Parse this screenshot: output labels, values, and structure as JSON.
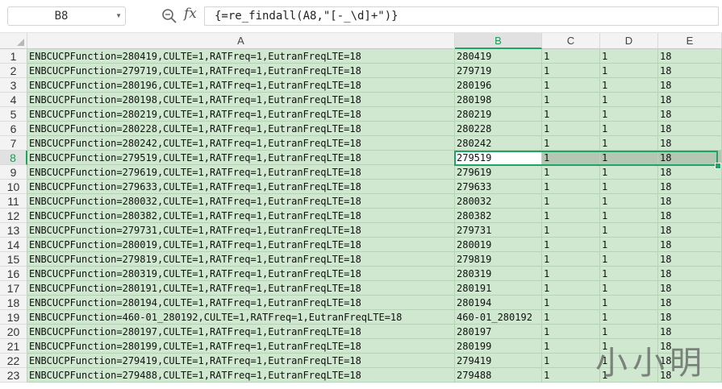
{
  "namebox": {
    "value": "B8"
  },
  "formula_bar": {
    "fx": "fx",
    "formula": "{=re_findall(A8,\"[-_\\d]+\")}"
  },
  "columns": [
    "A",
    "B",
    "C",
    "D",
    "E"
  ],
  "selected_column": "B",
  "selected_row": 8,
  "rows": [
    {
      "num": "1",
      "A": "ENBCUCPFunction=280419,CULTE=1,RATFreq=1,EutranFreqLTE=18",
      "B": "280419",
      "C": "1",
      "D": "1",
      "E": "18"
    },
    {
      "num": "2",
      "A": "ENBCUCPFunction=279719,CULTE=1,RATFreq=1,EutranFreqLTE=18",
      "B": "279719",
      "C": "1",
      "D": "1",
      "E": "18"
    },
    {
      "num": "3",
      "A": "ENBCUCPFunction=280196,CULTE=1,RATFreq=1,EutranFreqLTE=18",
      "B": "280196",
      "C": "1",
      "D": "1",
      "E": "18"
    },
    {
      "num": "4",
      "A": "ENBCUCPFunction=280198,CULTE=1,RATFreq=1,EutranFreqLTE=18",
      "B": "280198",
      "C": "1",
      "D": "1",
      "E": "18"
    },
    {
      "num": "5",
      "A": "ENBCUCPFunction=280219,CULTE=1,RATFreq=1,EutranFreqLTE=18",
      "B": "280219",
      "C": "1",
      "D": "1",
      "E": "18"
    },
    {
      "num": "6",
      "A": "ENBCUCPFunction=280228,CULTE=1,RATFreq=1,EutranFreqLTE=18",
      "B": "280228",
      "C": "1",
      "D": "1",
      "E": "18"
    },
    {
      "num": "7",
      "A": "ENBCUCPFunction=280242,CULTE=1,RATFreq=1,EutranFreqLTE=18",
      "B": "280242",
      "C": "1",
      "D": "1",
      "E": "18"
    },
    {
      "num": "8",
      "A": "ENBCUCPFunction=279519,CULTE=1,RATFreq=1,EutranFreqLTE=18",
      "B": "279519",
      "C": "1",
      "D": "1",
      "E": "18"
    },
    {
      "num": "9",
      "A": "ENBCUCPFunction=279619,CULTE=1,RATFreq=1,EutranFreqLTE=18",
      "B": "279619",
      "C": "1",
      "D": "1",
      "E": "18"
    },
    {
      "num": "10",
      "A": "ENBCUCPFunction=279633,CULTE=1,RATFreq=1,EutranFreqLTE=18",
      "B": "279633",
      "C": "1",
      "D": "1",
      "E": "18"
    },
    {
      "num": "11",
      "A": "ENBCUCPFunction=280032,CULTE=1,RATFreq=1,EutranFreqLTE=18",
      "B": "280032",
      "C": "1",
      "D": "1",
      "E": "18"
    },
    {
      "num": "12",
      "A": "ENBCUCPFunction=280382,CULTE=1,RATFreq=1,EutranFreqLTE=18",
      "B": "280382",
      "C": "1",
      "D": "1",
      "E": "18"
    },
    {
      "num": "13",
      "A": "ENBCUCPFunction=279731,CULTE=1,RATFreq=1,EutranFreqLTE=18",
      "B": "279731",
      "C": "1",
      "D": "1",
      "E": "18"
    },
    {
      "num": "14",
      "A": "ENBCUCPFunction=280019,CULTE=1,RATFreq=1,EutranFreqLTE=18",
      "B": "280019",
      "C": "1",
      "D": "1",
      "E": "18"
    },
    {
      "num": "15",
      "A": "ENBCUCPFunction=279819,CULTE=1,RATFreq=1,EutranFreqLTE=18",
      "B": "279819",
      "C": "1",
      "D": "1",
      "E": "18"
    },
    {
      "num": "16",
      "A": "ENBCUCPFunction=280319,CULTE=1,RATFreq=1,EutranFreqLTE=18",
      "B": "280319",
      "C": "1",
      "D": "1",
      "E": "18"
    },
    {
      "num": "17",
      "A": "ENBCUCPFunction=280191,CULTE=1,RATFreq=1,EutranFreqLTE=18",
      "B": "280191",
      "C": "1",
      "D": "1",
      "E": "18"
    },
    {
      "num": "18",
      "A": "ENBCUCPFunction=280194,CULTE=1,RATFreq=1,EutranFreqLTE=18",
      "B": "280194",
      "C": "1",
      "D": "1",
      "E": "18"
    },
    {
      "num": "19",
      "A": "ENBCUCPFunction=460-01_280192,CULTE=1,RATFreq=1,EutranFreqLTE=18",
      "B": "460-01_280192",
      "C": "1",
      "D": "1",
      "E": "18"
    },
    {
      "num": "20",
      "A": "ENBCUCPFunction=280197,CULTE=1,RATFreq=1,EutranFreqLTE=18",
      "B": "280197",
      "C": "1",
      "D": "1",
      "E": "18"
    },
    {
      "num": "21",
      "A": "ENBCUCPFunction=280199,CULTE=1,RATFreq=1,EutranFreqLTE=18",
      "B": "280199",
      "C": "1",
      "D": "1",
      "E": "18"
    },
    {
      "num": "22",
      "A": "ENBCUCPFunction=279419,CULTE=1,RATFreq=1,EutranFreqLTE=18",
      "B": "279419",
      "C": "1",
      "D": "1",
      "E": "18"
    },
    {
      "num": "23",
      "A": "ENBCUCPFunction=279488,CULTE=1,RATFreq=1,EutranFreqLTE=18",
      "B": "279488",
      "C": "1",
      "D": "1",
      "E": "18"
    }
  ],
  "watermark": "小小明",
  "colors": {
    "accent": "#21a366",
    "cell_fill": "#cfe8cf",
    "header_bg": "#f3f3f3"
  },
  "icons": {
    "zoom": "zoom-in-icon",
    "dropdown": "chevron-down-icon"
  }
}
